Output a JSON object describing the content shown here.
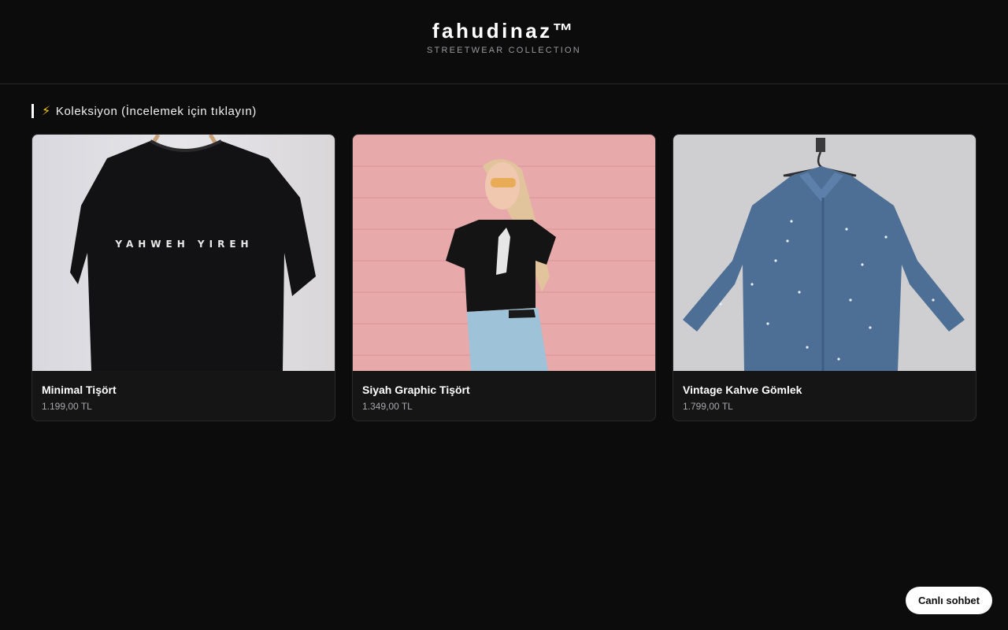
{
  "header": {
    "brand": "fahudinaz™",
    "tagline": "STREETWEAR COLLECTION"
  },
  "section": {
    "icon": "lightning-bolt-icon",
    "title": "Koleksiyon (İncelemek için tıklayın)"
  },
  "products": [
    {
      "name": "Minimal Tişört",
      "price": "1.199,00 TL",
      "image": "black-tshirt-on-hanger",
      "print_text": "YAHWEH YIREH"
    },
    {
      "name": "Siyah Graphic Tişört",
      "price": "1.349,00 TL",
      "image": "woman-black-graphic-tee-pink-wall"
    },
    {
      "name": "Vintage Kahve Gömlek",
      "price": "1.799,00 TL",
      "image": "denim-dotted-shirt-on-hanger"
    }
  ],
  "chat": {
    "label": "Canlı sohbet"
  },
  "colors": {
    "background": "#0c0c0d",
    "card": "#151516",
    "accent": "#ffffff",
    "bolt": "#f5c518"
  }
}
